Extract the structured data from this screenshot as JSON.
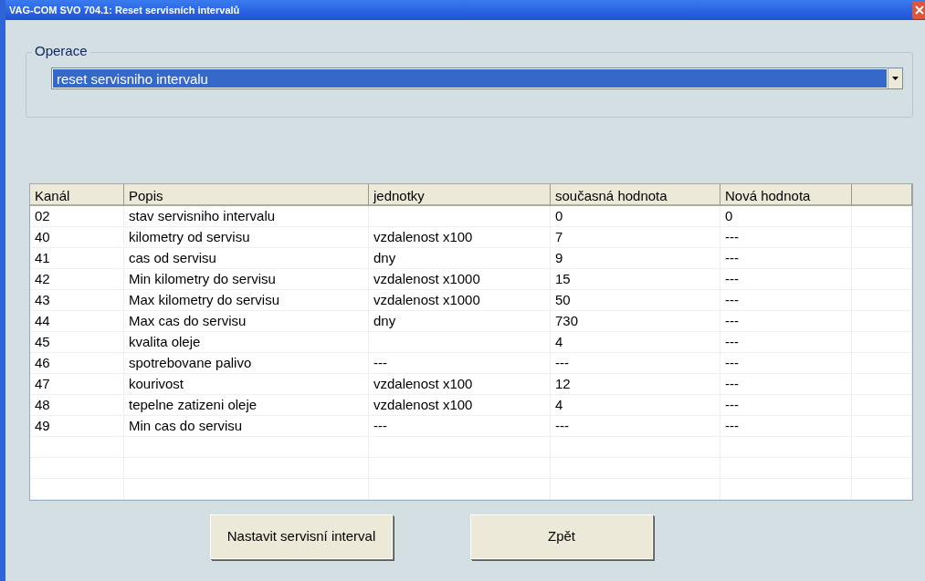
{
  "window": {
    "title": "VAG-COM SVO 704.1:  Reset servisních intervalů"
  },
  "operation": {
    "label": "Operace",
    "value": "reset servisniho intervalu"
  },
  "table": {
    "columns": [
      "Kanál",
      "Popis",
      "jednotky",
      "současná hodnota",
      "Nová hodnota"
    ],
    "rows": [
      [
        "02",
        "stav servisniho intervalu",
        "",
        "0",
        "0"
      ],
      [
        "40",
        "kilometry od servisu",
        "vzdalenost x100",
        "7",
        "---"
      ],
      [
        "41",
        "cas od servisu",
        "dny",
        "9",
        "---"
      ],
      [
        "42",
        "Min kilometry do servisu",
        "vzdalenost x1000",
        "15",
        "---"
      ],
      [
        "43",
        "Max kilometry do servisu",
        "vzdalenost x1000",
        "50",
        "---"
      ],
      [
        "44",
        "Max cas do servisu",
        "dny",
        "730",
        "---"
      ],
      [
        "45",
        "kvalita oleje",
        "",
        "4",
        "---"
      ],
      [
        "46",
        "spotrebovane palivo",
        "---",
        "---",
        "---"
      ],
      [
        "47",
        "kourivost",
        "vzdalenost x100",
        "12",
        "---"
      ],
      [
        "48",
        "tepelne zatizeni oleje",
        "vzdalenost x100",
        "4",
        "---"
      ],
      [
        "49",
        "Min cas do servisu",
        "---",
        "---",
        "---"
      ]
    ]
  },
  "buttons": [
    "Nastavit servisní interval",
    "Zpět"
  ]
}
